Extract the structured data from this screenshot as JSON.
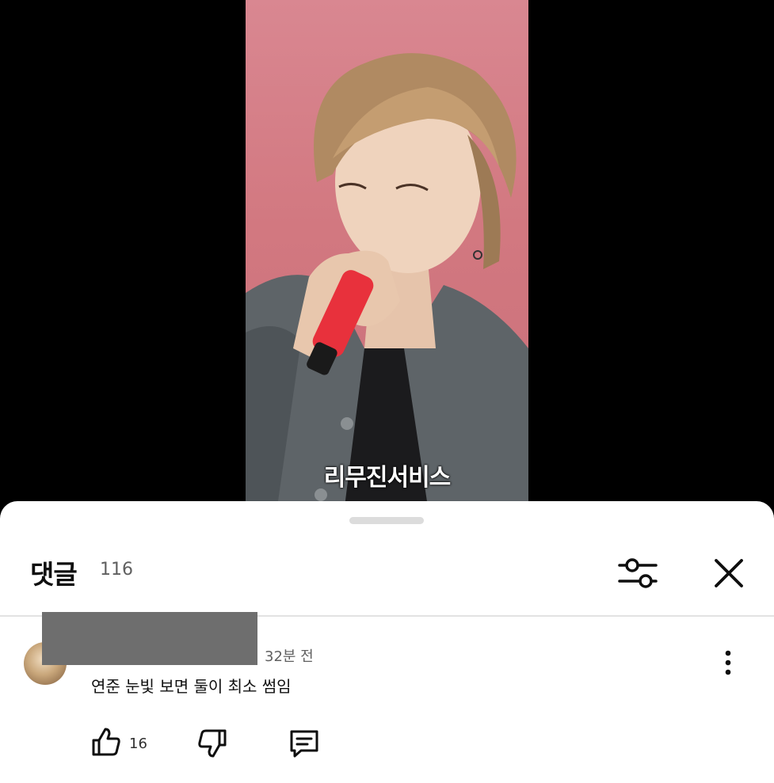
{
  "video": {
    "watermark": "리무진서비스"
  },
  "comments_panel": {
    "title": "댓글",
    "count": "116",
    "icons": {
      "filter": "sliders-icon",
      "close": "close-icon"
    }
  },
  "comment": {
    "time": "32분 전",
    "text": "연준 눈빛 보면 둘이 최소 썸임",
    "likes": "16",
    "icons": {
      "more": "more-vertical-icon",
      "like": "thumbs-up-icon",
      "dislike": "thumbs-down-icon",
      "reply": "reply-icon"
    }
  },
  "colors": {
    "video_background": "#d27880",
    "sheet": "#ffffff",
    "redaction": "#6e6e6e",
    "microphone": "#e8313c"
  }
}
